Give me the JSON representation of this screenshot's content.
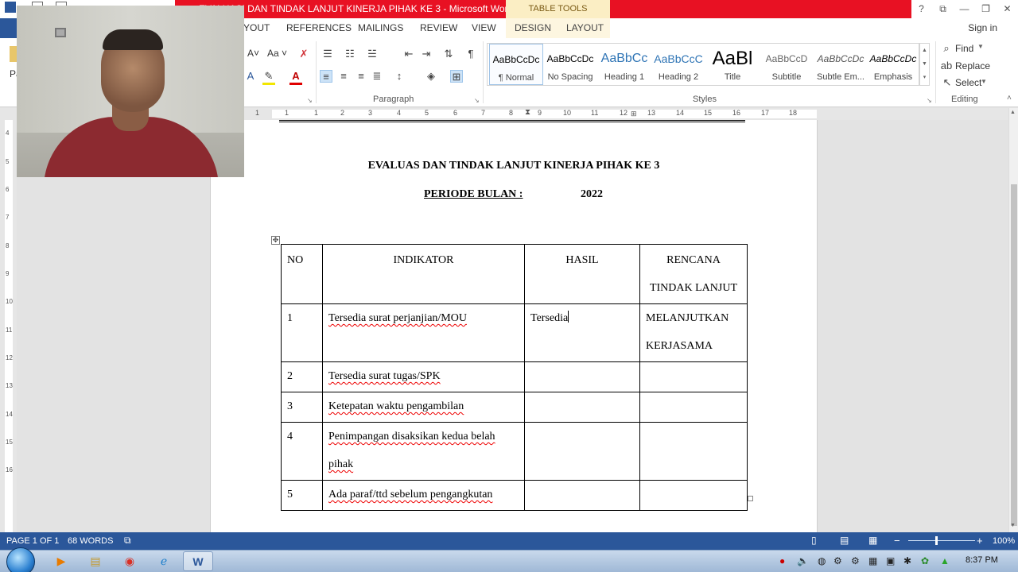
{
  "window": {
    "title": "EVALUASI DAN TINDAK LANJUT KINERJA PIHAK KE 3 - Microsoft Word",
    "contextual_tab_group": "TABLE TOOLS",
    "controls": {
      "help": "?",
      "ribbon_options": "⧉",
      "minimize": "—",
      "restore": "❐",
      "close": "✕"
    }
  },
  "tabs": {
    "layout_partial": "YOUT",
    "references": "REFERENCES",
    "mailings": "MAILINGS",
    "review": "REVIEW",
    "view": "VIEW",
    "design": "DESIGN",
    "layout": "LAYOUT",
    "signin": "Sign in"
  },
  "ribbon": {
    "paste_partial": "Pa",
    "paragraph_label": "Paragraph",
    "styles_label": "Styles",
    "editing_label": "Editing",
    "font": {
      "shrink": "A˅",
      "case": "Aa ˅"
    },
    "styles": [
      {
        "preview": "AaBbCcDc",
        "name": "¶ Normal"
      },
      {
        "preview": "AaBbCcDc",
        "name": "No Spacing"
      },
      {
        "preview": "AaBbCc",
        "name": "Heading 1"
      },
      {
        "preview": "AaBbCcC",
        "name": "Heading 2"
      },
      {
        "preview": "AaBl",
        "name": "Title"
      },
      {
        "preview": "AaBbCcD",
        "name": "Subtitle"
      },
      {
        "preview": "AaBbCcDc",
        "name": "Subtle Em..."
      },
      {
        "preview": "AaBbCcDc",
        "name": "Emphasis"
      }
    ],
    "editing": {
      "find": "Find",
      "replace": "Replace",
      "select": "Select"
    }
  },
  "ruler": {
    "h_numbers": [
      "1",
      "1",
      "1",
      "2",
      "3",
      "4",
      "5",
      "6",
      "7",
      "8",
      "9",
      "10",
      "11",
      "12",
      "13",
      "14",
      "15",
      "16",
      "17",
      "18"
    ],
    "v_numbers": [
      "4",
      "5",
      "6",
      "7",
      "8",
      "9",
      "10",
      "11",
      "12",
      "13",
      "14",
      "15",
      "16"
    ]
  },
  "document": {
    "title_line": "EVALUAS DAN TINDAK LANJUT KINERJA PIHAK KE 3",
    "period_label": "PERIODE  BULAN :",
    "period_year": "2022",
    "table": {
      "headers": {
        "no": "NO",
        "indikator": "INDIKATOR",
        "hasil": "HASIL",
        "rencana_1": "RENCANA",
        "rencana_2": "TINDAK LANJUT"
      },
      "rows": [
        {
          "no": "1",
          "indikator": "Tersedia surat perjanjian/MOU",
          "hasil": "Tersedia",
          "rencana_1": "MELANJUTKAN",
          "rencana_2": "KERJASAMA"
        },
        {
          "no": "2",
          "indikator": "Tersedia surat tugas/SPK",
          "hasil": "",
          "rencana_1": ""
        },
        {
          "no": "3",
          "indikator": "Ketepatan waktu pengambilan",
          "hasil": "",
          "rencana_1": ""
        },
        {
          "no": "4",
          "indikator_1": "Penimpangan disaksikan kedua belah",
          "indikator_2": "pihak",
          "hasil": "",
          "rencana_1": ""
        },
        {
          "no": "5",
          "indikator": "Ada paraf/ttd sebelum pengangkutan",
          "hasil": "",
          "rencana_1": ""
        }
      ]
    }
  },
  "status": {
    "page": "PAGE 1 OF 1",
    "words": "68 WORDS",
    "zoom": "100%",
    "zoom_minus": "−",
    "zoom_plus": "+"
  },
  "taskbar": {
    "clock": "8:37 PM"
  }
}
